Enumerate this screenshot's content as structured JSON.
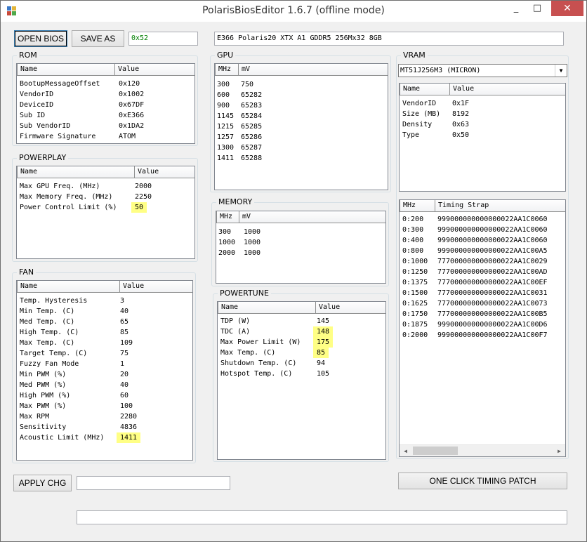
{
  "window": {
    "title": "PolarisBiosEditor 1.6.7 (offline mode)",
    "minimize": "_",
    "maximize": "□",
    "close": "✕"
  },
  "toolbar": {
    "open_bios": "OPEN BIOS",
    "save_as": "SAVE AS",
    "checksum": "0x52",
    "bios_name": "E366 Polaris20 XTX A1 GDDR5 256Mx32 8GB"
  },
  "rom": {
    "label": "ROM",
    "headers": [
      "Name",
      "Value"
    ],
    "rows": [
      [
        "BootupMessageOffset",
        "0x120"
      ],
      [
        "VendorID",
        "0x1002"
      ],
      [
        "DeviceID",
        "0x67DF"
      ],
      [
        "Sub ID",
        "0xE366"
      ],
      [
        "Sub VendorID",
        "0x1DA2"
      ],
      [
        "Firmware Signature",
        "ATOM"
      ]
    ]
  },
  "powerplay": {
    "label": "POWERPLAY",
    "headers": [
      "Name",
      "Value"
    ],
    "rows": [
      [
        "Max GPU Freq. (MHz)",
        "2000"
      ],
      [
        "Max Memory Freq. (MHz)",
        "2250"
      ],
      [
        "Power Control Limit (%)",
        "50"
      ]
    ]
  },
  "fan": {
    "label": "FAN",
    "headers": [
      "Name",
      "Value"
    ],
    "rows": [
      [
        "Temp. Hysteresis",
        "3"
      ],
      [
        "Min Temp. (C)",
        "40"
      ],
      [
        "Med Temp. (C)",
        "65"
      ],
      [
        "High Temp. (C)",
        "85"
      ],
      [
        "Max Temp. (C)",
        "109"
      ],
      [
        "Target Temp. (C)",
        "75"
      ],
      [
        "Fuzzy Fan Mode",
        "1"
      ],
      [
        "Min PWM (%)",
        "20"
      ],
      [
        "Med PWM (%)",
        "40"
      ],
      [
        "High PWM (%)",
        "60"
      ],
      [
        "Max PWM (%)",
        "100"
      ],
      [
        "Max RPM",
        "2280"
      ],
      [
        "Sensitivity",
        "4836"
      ],
      [
        "Acoustic Limit (MHz)",
        "1411"
      ]
    ]
  },
  "gpu": {
    "label": "GPU",
    "headers": [
      "MHz",
      "mV"
    ],
    "rows": [
      [
        "300",
        "750"
      ],
      [
        "600",
        "65282"
      ],
      [
        "900",
        "65283"
      ],
      [
        "1145",
        "65284"
      ],
      [
        "1215",
        "65285"
      ],
      [
        "1257",
        "65286"
      ],
      [
        "1300",
        "65287"
      ],
      [
        "1411",
        "65288"
      ]
    ]
  },
  "memory": {
    "label": "MEMORY",
    "headers": [
      "MHz",
      "mV"
    ],
    "rows": [
      [
        "300",
        "1000"
      ],
      [
        "1000",
        "1000"
      ],
      [
        "2000",
        "1000"
      ]
    ]
  },
  "powertune": {
    "label": "POWERTUNE",
    "headers": [
      "Name",
      "Value"
    ],
    "rows": [
      [
        "TDP (W)",
        "145"
      ],
      [
        "TDC (A)",
        "148"
      ],
      [
        "Max Power Limit (W)",
        "175"
      ],
      [
        "Max Temp. (C)",
        "85"
      ],
      [
        "Shutdown Temp. (C)",
        "94"
      ],
      [
        "Hotspot Temp. (C)",
        "105"
      ]
    ]
  },
  "vram": {
    "label": "VRAM",
    "selected_chip": "MT51J256M3 (MICRON)",
    "headers": [
      "Name",
      "Value"
    ],
    "rows": [
      [
        "VendorID",
        "0x1F"
      ],
      [
        "Size (MB)",
        "8192"
      ],
      [
        "Density",
        "0x63"
      ],
      [
        "Type",
        "0x50"
      ]
    ],
    "timing_headers": [
      "MHz",
      "Timing Strap"
    ],
    "timings": [
      [
        "0:200",
        "999000000000000022AA1C0060"
      ],
      [
        "0:300",
        "999000000000000022AA1C0060"
      ],
      [
        "0:400",
        "999000000000000022AA1C0060"
      ],
      [
        "0:800",
        "999000000000000022AA1C00A5"
      ],
      [
        "0:1000",
        "777000000000000022AA1C0029"
      ],
      [
        "0:1250",
        "777000000000000022AA1C00AD"
      ],
      [
        "0:1375",
        "777000000000000022AA1C00EF"
      ],
      [
        "0:1500",
        "777000000000000022AA1C0031"
      ],
      [
        "0:1625",
        "777000000000000022AA1C0073"
      ],
      [
        "0:1750",
        "777000000000000022AA1C00B5"
      ],
      [
        "0:1875",
        "999000000000000022AA1C00D6"
      ],
      [
        "0:2000",
        "999000000000000022AA1C00F7"
      ]
    ]
  },
  "footer": {
    "apply": "APPLY CHG",
    "apply_field": "",
    "one_click": "ONE CLICK TIMING PATCH",
    "status": ""
  },
  "colors": {
    "highlight": "#ffff85",
    "checksum_text": "#008000"
  }
}
